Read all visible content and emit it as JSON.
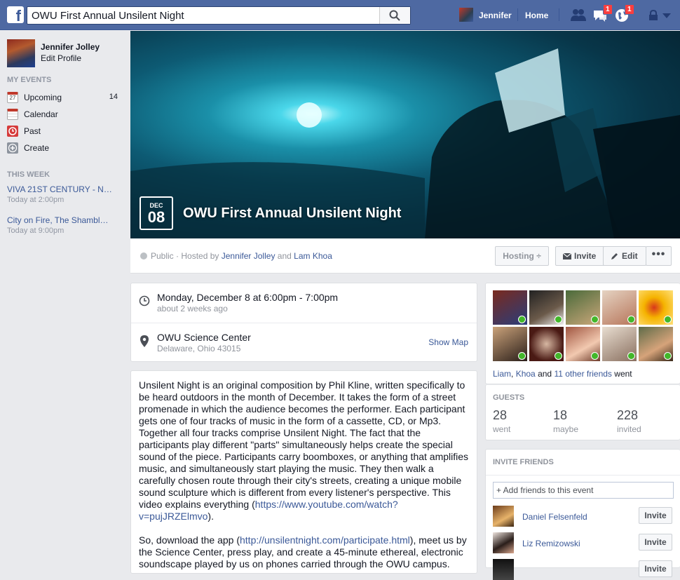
{
  "topbar": {
    "logo": "f",
    "search_value": "OWU First Annual Unsilent Night",
    "user_name": "Jennifer",
    "home_label": "Home",
    "friend_requests_badge": "",
    "messages_badge": "1",
    "notifications_badge": "1"
  },
  "sidebar": {
    "profile_name": "Jennifer Jolley",
    "edit_profile": "Edit Profile",
    "my_events_header": "MY EVENTS",
    "items": [
      {
        "label": "Upcoming",
        "count": "14",
        "icon": "calendar-27-icon"
      },
      {
        "label": "Calendar",
        "count": "",
        "icon": "calendar-icon"
      },
      {
        "label": "Past",
        "count": "",
        "icon": "clock-icon"
      },
      {
        "label": "Create",
        "count": "",
        "icon": "plus-icon"
      }
    ],
    "upcoming_icon_day": "27",
    "this_week_header": "THIS WEEK",
    "this_week": [
      {
        "title": "VIVA 21ST CENTURY - Nu...",
        "time": "Today at 2:00pm"
      },
      {
        "title": "City on Fire, The Shambles...",
        "time": "Today at 9:00pm"
      }
    ]
  },
  "event": {
    "month": "DEC",
    "day": "08",
    "title": "OWU First Annual Unsilent Night",
    "privacy": "Public · Hosted by",
    "host1": "Jennifer Jolley",
    "and": "and",
    "host2": "Lam Khoa",
    "hosting_btn": "Hosting ÷",
    "invite_btn": "Invite",
    "edit_btn": "Edit",
    "more_btn": "•••",
    "when_main": "Monday, December 8 at 6:00pm - 7:00pm",
    "when_sub": "about 2 weeks ago",
    "where_main": "OWU Science Center",
    "where_sub": "Delaware, Ohio 43015",
    "show_map": "Show Map",
    "desc_1": "Unsilent Night is an original composition by Phil Kline, written specifically to be heard outdoors in the month of December. It takes the form of a street promenade in which the audience becomes the performer. Each participant gets one of four tracks of music in the form of a cassette, CD, or Mp3. Together all four tracks comprise Unsilent Night. The fact that the participants play different \"parts\" simultaneously helps create the special sound of the piece. Participants carry boomboxes, or anything that amplifies music, and simultaneously start playing the music. They then walk a carefully chosen route through their city's streets, creating a unique mobile sound sculpture which is different from every listener's perspective. This video explains everything (",
    "desc_1_link": "https://www.youtube.com/watch?v=pujJRZElmvo",
    "desc_1_end": ").",
    "desc_2_start": "So, download the app (",
    "desc_2_link": "http://unsilentnight.com/participate.html",
    "desc_2_rest": "), meet us by the Science Center, press play, and create a 45-minute ethereal, electronic soundscape played by us on phones carried through the OWU campus."
  },
  "friends": {
    "went_friend1": "Liam",
    "went_friend2": "Khoa",
    "went_and": "and",
    "went_others": "11 other friends",
    "went_suffix": "went"
  },
  "guests": {
    "title": "GUESTS",
    "went_count": "28",
    "went_label": "went",
    "maybe_count": "18",
    "maybe_label": "maybe",
    "invited_count": "228",
    "invited_label": "invited"
  },
  "invite_friends": {
    "title": "INVITE FRIENDS",
    "placeholder": "+ Add friends to this event",
    "people": [
      {
        "name": "Daniel Felsenfeld",
        "button": "Invite"
      },
      {
        "name": "Liz Remizowski",
        "button": "Invite"
      },
      {
        "name": "",
        "button": "Invite"
      }
    ]
  }
}
